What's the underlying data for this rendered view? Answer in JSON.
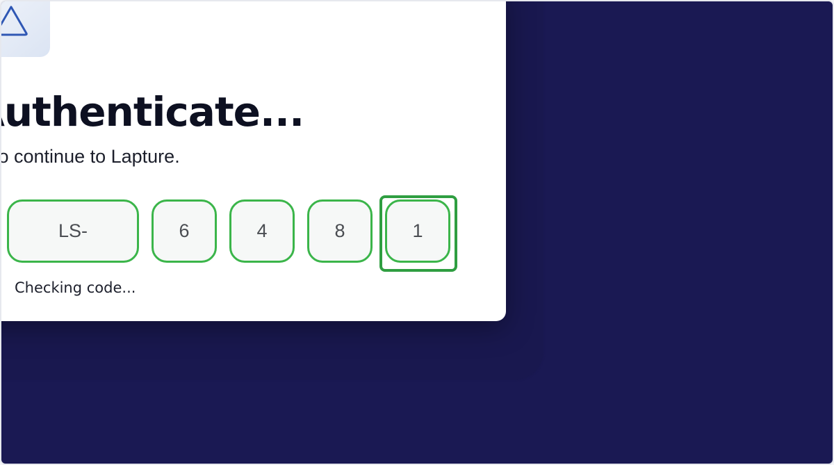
{
  "auth": {
    "title": "Authenticate...",
    "subtitle": "To continue to Lapture.",
    "logo_icon": "triangle-logo-icon",
    "code": {
      "prefix": "LS-",
      "digits": [
        "6",
        "4",
        "8",
        "1"
      ],
      "focused_index": 3
    },
    "status": "Checking code..."
  },
  "colors": {
    "background": "#1a1953",
    "card": "#ffffff",
    "accent_green": "#3bb54a",
    "focus_green": "#2f9e41",
    "logo_stroke": "#2f57b4"
  }
}
